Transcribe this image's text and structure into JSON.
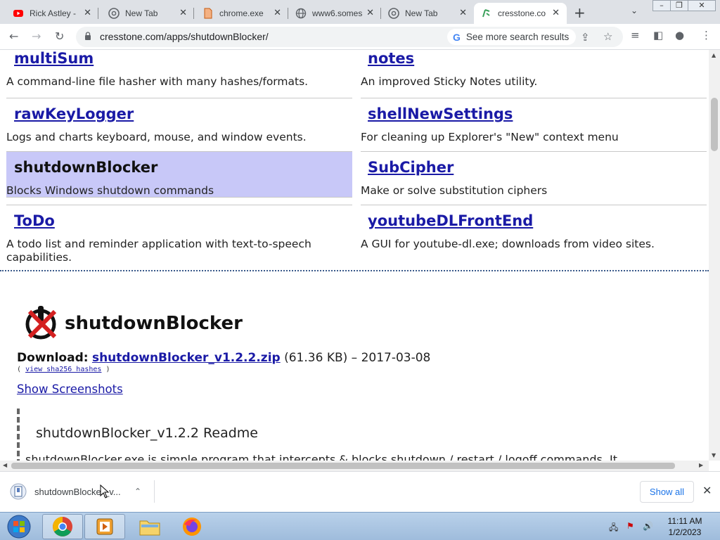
{
  "tabs": [
    {
      "title": "Rick Astley -",
      "icon": "youtube-icon"
    },
    {
      "title": "New Tab",
      "icon": "chrome-icon"
    },
    {
      "title": "chrome.exe",
      "icon": "document-icon"
    },
    {
      "title": "www6.somes",
      "icon": "globe-icon"
    },
    {
      "title": "New Tab",
      "icon": "chrome-icon"
    },
    {
      "title": "cresstone.co",
      "icon": "cresstone-icon",
      "active": true
    }
  ],
  "address_bar": {
    "url": "cresstone.com/apps/shutdownBlocker/",
    "search_chip": "See more search results"
  },
  "apps": [
    {
      "name": "multiSum",
      "desc": "A command-line file hasher with many hashes/formats."
    },
    {
      "name": "notes",
      "desc": "An improved Sticky Notes utility."
    },
    {
      "name": "rawKeyLogger",
      "desc": "Logs and charts keyboard, mouse, and window events."
    },
    {
      "name": "shellNewSettings",
      "desc": "For cleaning up Explorer's \"New\" context menu"
    },
    {
      "name": "shutdownBlocker",
      "desc": "Blocks Windows shutdown commands",
      "selected": true
    },
    {
      "name": "SubCipher",
      "desc": "Make or solve substitution ciphers"
    },
    {
      "name": "ToDo",
      "desc": "A todo list and reminder application with text-to-speech capabilities."
    },
    {
      "name": "youtubeDLFrontEnd",
      "desc": "A GUI for youtube-dl.exe; downloads from video sites."
    }
  ],
  "detail": {
    "title": "shutdownBlocker",
    "download_label": "Download:",
    "download_file": "shutdownBlocker_v1.2.2.zip",
    "download_meta": "(61.36 KB) – 2017-03-08",
    "hashes_open": "(",
    "hashes_link": "view sha256 hashes",
    "hashes_close": ")",
    "show_screenshots": "Show Screenshots",
    "readme_title": "shutdownBlocker_v1.2.2 Readme",
    "readme_text": "shutdownBlocker.exe is simple program that intercepts & blocks shutdown / restart / logoff commands. It"
  },
  "download_shelf": {
    "file_name": "shutdownBlocker_v...",
    "show_all": "Show all"
  },
  "taskbar": {
    "time": "11:11 AM",
    "date": "1/2/2023"
  }
}
